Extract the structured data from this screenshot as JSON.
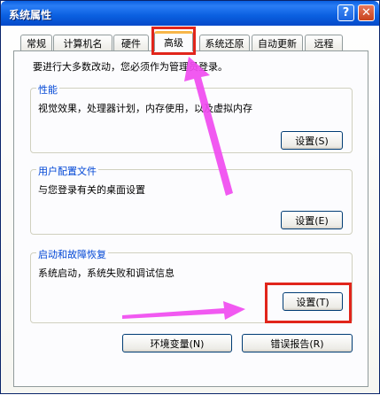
{
  "window": {
    "title": "系统属性",
    "help_label": "?",
    "close_label": "✕"
  },
  "tabs": [
    {
      "label": "常规"
    },
    {
      "label": "计算机名"
    },
    {
      "label": "硬件"
    },
    {
      "label": "高级"
    },
    {
      "label": "系统还原"
    },
    {
      "label": "自动更新"
    },
    {
      "label": "远程"
    }
  ],
  "active_tab": "高级",
  "notice": "要进行大多数改动，您必须作为管理员登录。",
  "groups": {
    "performance": {
      "title": "性能",
      "description": "视觉效果，处理器计划，内存使用，以及虚拟内存",
      "button": "设置(S)"
    },
    "user_profiles": {
      "title": "用户配置文件",
      "description": "与您登录有关的桌面设置",
      "button": "设置(E)"
    },
    "startup_recovery": {
      "title": "启动和故障恢复",
      "description": "系统启动，系统失败和调试信息",
      "button": "设置(T)"
    }
  },
  "bottom_buttons": {
    "env_vars": "环境变量(N)",
    "error_report": "错误报告(R)"
  },
  "colors": {
    "titlebar": "#0a5fe0",
    "group_title": "#0046d5",
    "highlight": "#e1251b",
    "arrow": "#f04bf0"
  }
}
